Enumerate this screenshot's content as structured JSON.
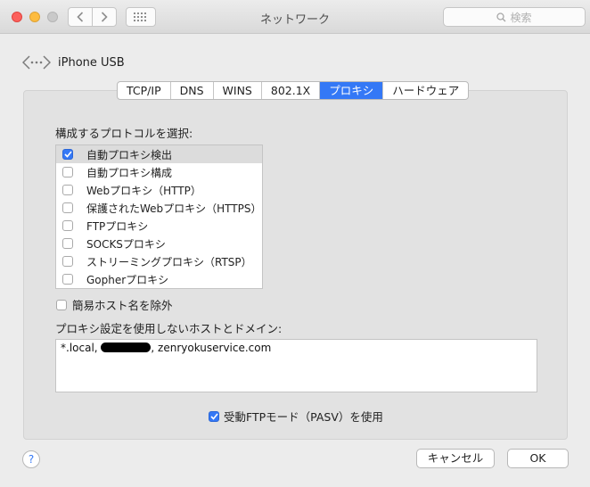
{
  "window": {
    "title": "ネットワーク",
    "search_placeholder": "検索"
  },
  "interface": {
    "name": "iPhone USB"
  },
  "tabs": [
    {
      "label": "TCP/IP",
      "active": false
    },
    {
      "label": "DNS",
      "active": false
    },
    {
      "label": "WINS",
      "active": false
    },
    {
      "label": "802.1X",
      "active": false
    },
    {
      "label": "プロキシ",
      "active": true
    },
    {
      "label": "ハードウェア",
      "active": false
    }
  ],
  "protocols": {
    "heading": "構成するプロトコルを選択:",
    "items": [
      {
        "label": "自動プロキシ検出",
        "checked": true,
        "selected": true
      },
      {
        "label": "自動プロキシ構成",
        "checked": false,
        "selected": false
      },
      {
        "label": "Webプロキシ（HTTP）",
        "checked": false,
        "selected": false
      },
      {
        "label": "保護されたWebプロキシ（HTTPS）",
        "checked": false,
        "selected": false
      },
      {
        "label": "FTPプロキシ",
        "checked": false,
        "selected": false
      },
      {
        "label": "SOCKSプロキシ",
        "checked": false,
        "selected": false
      },
      {
        "label": "ストリーミングプロキシ（RTSP）",
        "checked": false,
        "selected": false
      },
      {
        "label": "Gopherプロキシ",
        "checked": false,
        "selected": false
      }
    ]
  },
  "simple_hosts": {
    "label": "簡易ホスト名を除外",
    "checked": false
  },
  "bypass": {
    "heading": "プロキシ設定を使用しないホストとドメイン:",
    "value_start": "*.local, ",
    "value_end": ", zenryokuservice.com"
  },
  "pasv": {
    "label": "受動FTPモード（PASV）を使用",
    "checked": true
  },
  "buttons": {
    "help": "?",
    "cancel": "キャンセル",
    "ok": "OK"
  },
  "colors": {
    "accent": "#3478f6",
    "close": "#fc615d",
    "minimize": "#fdbc40"
  }
}
